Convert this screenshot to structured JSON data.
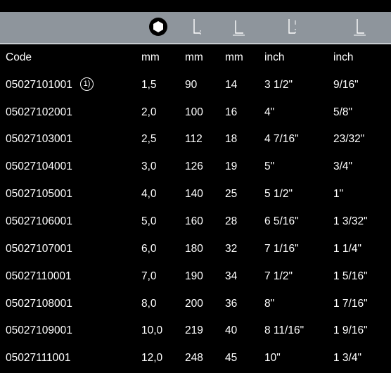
{
  "header_icons": [
    "hex-socket-icon",
    "dimension-d1-icon",
    "dimension-l-icon",
    "dimension-d2-icon",
    "dimension-l2-icon"
  ],
  "units": {
    "code": "Code",
    "d1": "mm",
    "d2": "mm",
    "d3": "mm",
    "d4": "inch",
    "d5": "inch"
  },
  "footnote_mark": "1)",
  "rows": [
    {
      "code": "05027101001",
      "d1": "1,5",
      "d2": "90",
      "d3": "14",
      "d4": "3 1/2\"",
      "d5": "9/16\""
    },
    {
      "code": "05027102001",
      "d1": "2,0",
      "d2": "100",
      "d3": "16",
      "d4": "4\"",
      "d5": "5/8\""
    },
    {
      "code": "05027103001",
      "d1": "2,5",
      "d2": "112",
      "d3": "18",
      "d4": "4 7/16\"",
      "d5": "23/32\""
    },
    {
      "code": "05027104001",
      "d1": "3,0",
      "d2": "126",
      "d3": "19",
      "d4": "5\"",
      "d5": "3/4\""
    },
    {
      "code": "05027105001",
      "d1": "4,0",
      "d2": "140",
      "d3": "25",
      "d4": "5 1/2\"",
      "d5": "1\""
    },
    {
      "code": "05027106001",
      "d1": "5,0",
      "d2": "160",
      "d3": "28",
      "d4": "6 5/16\"",
      "d5": "1 3/32\""
    },
    {
      "code": "05027107001",
      "d1": "6,0",
      "d2": "180",
      "d3": "32",
      "d4": "7 1/16\"",
      "d5": "1 1/4\""
    },
    {
      "code": "05027110001",
      "d1": "7,0",
      "d2": "190",
      "d3": "34",
      "d4": "7 1/2\"",
      "d5": "1 5/16\""
    },
    {
      "code": "05027108001",
      "d1": "8,0",
      "d2": "200",
      "d3": "36",
      "d4": "8\"",
      "d5": "1 7/16\""
    },
    {
      "code": "05027109001",
      "d1": "10,0",
      "d2": "219",
      "d3": "40",
      "d4": "8 11/16\"",
      "d5": "1 9/16\""
    },
    {
      "code": "05027111001",
      "d1": "12,0",
      "d2": "248",
      "d3": "45",
      "d4": "10\"",
      "d5": "1 3/4\""
    }
  ]
}
